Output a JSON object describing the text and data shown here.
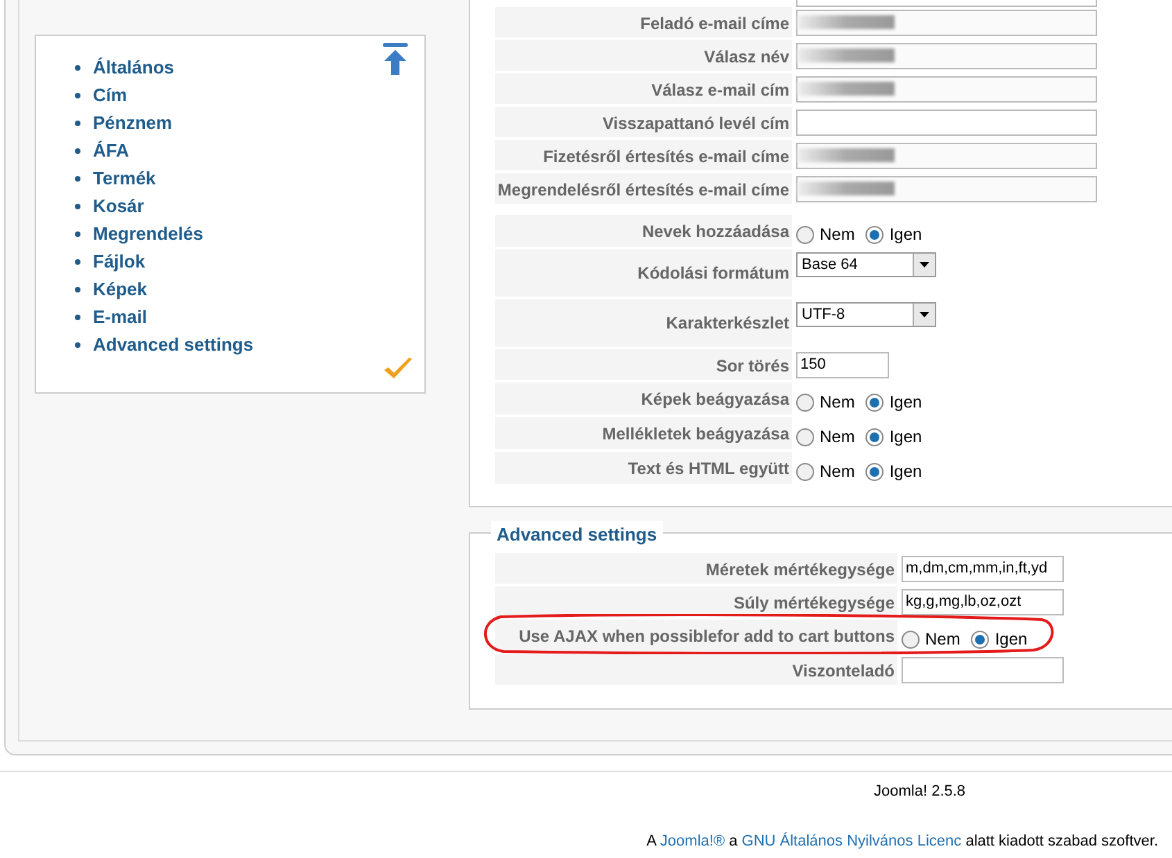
{
  "nav": {
    "items": [
      "Általános",
      "Cím",
      "Pénznem",
      "ÁFA",
      "Termék",
      "Kosár",
      "Megrendelés",
      "Fájlok",
      "Képek",
      "E-mail",
      "Advanced settings"
    ]
  },
  "email_groups": [
    {
      "rows": [
        {
          "label": "Feladó e-mail címe",
          "kind": "text",
          "redacted": true
        },
        {
          "label": "Válasz név",
          "kind": "text",
          "redacted": true
        },
        {
          "label": "Válasz e-mail cím",
          "kind": "text",
          "redacted": true
        },
        {
          "label": "Visszapattanó levél cím",
          "kind": "text",
          "redacted": false
        },
        {
          "label": "Fizetésről értesítés e-mail címe",
          "kind": "text",
          "redacted": true
        },
        {
          "label": "Megrendelésről értesítés e-mail címe",
          "kind": "text",
          "redacted": true
        }
      ]
    },
    {
      "rows": [
        {
          "label": "Nevek hozzáadása",
          "kind": "radio",
          "options": [
            {
              "label": "Nem",
              "selected": false
            },
            {
              "label": "Igen",
              "selected": true
            }
          ]
        },
        {
          "label": "Kódolási formátum",
          "kind": "select",
          "value": "Base 64"
        },
        {
          "label": "Karakterkészlet",
          "kind": "select",
          "value": "UTF-8"
        },
        {
          "label": "Sor törés",
          "kind": "short",
          "value": "150"
        },
        {
          "label": "Képek beágyazása",
          "kind": "radio",
          "options": [
            {
              "label": "Nem",
              "selected": false
            },
            {
              "label": "Igen",
              "selected": true
            }
          ]
        },
        {
          "label": "Mellékletek beágyazása",
          "kind": "radio",
          "options": [
            {
              "label": "Nem",
              "selected": false
            },
            {
              "label": "Igen",
              "selected": true
            }
          ]
        },
        {
          "label": "Text és HTML együtt",
          "kind": "radio",
          "options": [
            {
              "label": "Nem",
              "selected": false
            },
            {
              "label": "Igen",
              "selected": true
            }
          ]
        }
      ]
    }
  ],
  "advanced": {
    "legend": "Advanced settings",
    "rows": [
      {
        "label": "Méretek mértékegysége",
        "kind": "text",
        "value": "m,dm,cm,mm,in,ft,yd"
      },
      {
        "label": "Súly mértékegysége",
        "kind": "text",
        "value": "kg,g,mg,lb,oz,ozt"
      },
      {
        "label": "Use AJAX when possiblefor add to cart buttons",
        "kind": "radio",
        "highlighted": true,
        "options": [
          {
            "label": "Nem",
            "selected": false
          },
          {
            "label": "Igen",
            "selected": true
          }
        ]
      },
      {
        "label": "Viszonteladó",
        "kind": "text"
      }
    ]
  },
  "footer": {
    "version": "Joomla! 2.5.8",
    "license": [
      {
        "kind": "text",
        "text": "A "
      },
      {
        "kind": "link",
        "text": "Joomla!®"
      },
      {
        "kind": "text",
        "text": " a "
      },
      {
        "kind": "link",
        "text": "GNU Általános Nyilvános Licenc"
      },
      {
        "kind": "text",
        "text": " alatt kiadott szabad szoftver."
      }
    ]
  }
}
